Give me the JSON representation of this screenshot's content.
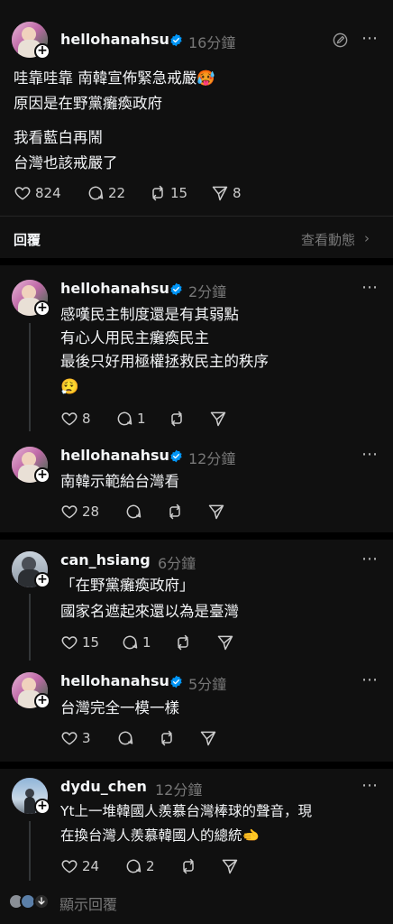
{
  "main_post": {
    "username": "hellohanahsu",
    "time": "16分鐘",
    "lines": [
      "哇靠哇靠 南韓宣佈緊急戒嚴🥵",
      "原因是在野黨癱瘓政府",
      "我看藍白再鬧",
      "台灣也該戒嚴了"
    ],
    "likes": "824",
    "comments": "22",
    "reposts": "15",
    "shares": "8"
  },
  "replies_header": {
    "label": "回覆",
    "activity": "查看動態",
    "chevron": "›"
  },
  "replies": [
    {
      "username": "hellohanahsu",
      "time": "2分鐘",
      "lines": [
        "感嘆民主制度還是有其弱點",
        "有心人用民主癱瘓民主",
        "最後只好用極權拯救民主的秩序",
        "😮‍💨"
      ],
      "likes": "8",
      "comments": "1"
    },
    {
      "username": "hellohanahsu",
      "time": "12分鐘",
      "lines": [
        "南韓示範給台灣看"
      ],
      "likes": "28"
    },
    {
      "username": "can_hsiang",
      "time": "6分鐘",
      "lines": [
        "「在野黨癱瘓政府」",
        "國家名遮起來還以為是臺灣"
      ],
      "likes": "15",
      "comments": "1"
    },
    {
      "username": "hellohanahsu",
      "time": "5分鐘",
      "lines": [
        "台灣完全一模一樣"
      ],
      "likes": "3"
    },
    {
      "username": "dydu_chen",
      "time": "12分鐘",
      "lines": [
        "Yt上一堆韓國人羨慕台灣棒球的聲音，現",
        "在換台灣人羨慕韓國人的總統🫲"
      ],
      "likes": "24",
      "comments": "2"
    }
  ],
  "footer": {
    "show_replies": "顯示回覆"
  },
  "icons": {
    "more": "⋯",
    "plus": "+"
  },
  "colors": {
    "background": "#101010",
    "verified": "#0095f6",
    "muted": "#777777"
  }
}
